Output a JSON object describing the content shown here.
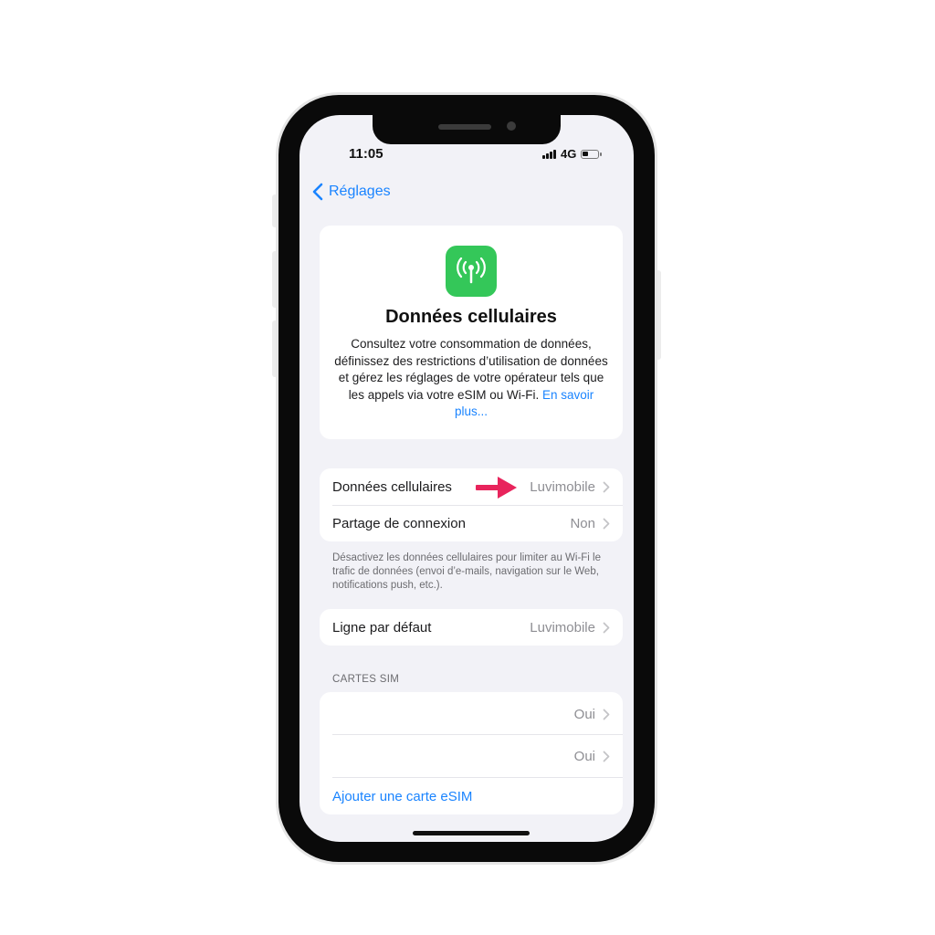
{
  "status_bar": {
    "time": "11:05",
    "network": "4G"
  },
  "nav": {
    "back_label": "Réglages"
  },
  "hero": {
    "icon": "cellular-antenna-icon",
    "title": "Données cellulaires",
    "description": "Consultez votre consommation de données, définissez des restrictions d’utilisation de données et gérez les réglages de votre opérateur tels que les appels via votre eSIM ou Wi-Fi.",
    "learn_more": "En savoir plus..."
  },
  "group1": [
    {
      "label": "Données cellulaires",
      "value": "Luvimobile"
    },
    {
      "label": "Partage de connexion",
      "value": "Non"
    }
  ],
  "group1_footer": "Désactivez les données cellulaires pour limiter au Wi-Fi le trafic de données (envoi d’e-mails, navigation sur le Web, notifications push, etc.).",
  "group2": [
    {
      "label": "Ligne par défaut",
      "value": "Luvimobile"
    }
  ],
  "sim_section": {
    "header": "CARTES SIM",
    "rows": [
      {
        "label": "",
        "value": "Oui"
      },
      {
        "label": "",
        "value": "Oui"
      }
    ],
    "add_label": "Ajouter une carte eSIM"
  },
  "colors": {
    "accent": "#1a84ff",
    "icon_green": "#34c759",
    "annotation_arrow": "#e8245c",
    "background": "#f2f2f7"
  }
}
